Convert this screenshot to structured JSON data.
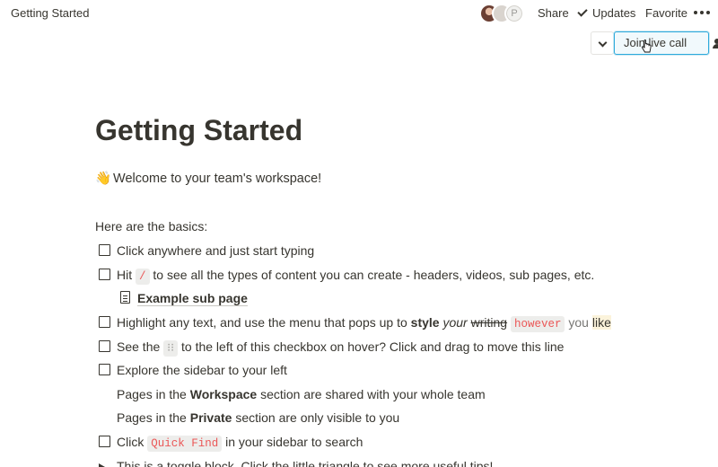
{
  "topbar": {
    "breadcrumb": "Getting Started",
    "avatar_initial": "P",
    "share_label": "Share",
    "updates_label": "Updates",
    "favorite_label": "Favorite"
  },
  "call": {
    "join_label": "Join live call"
  },
  "page": {
    "title": "Getting Started",
    "welcome": "Welcome to your team's workspace!",
    "basics": "Here are the basics:",
    "items": {
      "click": "Click anywhere and just start typing",
      "hit_pre": "Hit",
      "hit_code": "/",
      "hit_post": "to see all the types of content you can create - headers, videos, sub pages, etc.",
      "subpage": "Example sub page",
      "highlight_pre": "Highlight any text, and use the menu that pops up to",
      "highlight_style": "style",
      "highlight_your": "your",
      "highlight_writing": "writing",
      "highlight_however": "however",
      "highlight_you": "you",
      "highlight_like": "like",
      "see_pre": "See the",
      "see_code": "⁝⁝",
      "see_post": "to the left of this checkbox on hover? Click and drag to move this line",
      "explore": "Explore the sidebar to your left",
      "workspace_pre": "Pages in the",
      "workspace_bold": "Workspace",
      "workspace_post": "section are shared with your whole team",
      "private_pre": "Pages in the",
      "private_bold": "Private",
      "private_post": "section are only visible to you",
      "quick_pre": "Click",
      "quick_code": "Quick Find",
      "quick_post": "in your sidebar to search",
      "toggle": "This is a toggle block. Click the little triangle to see more useful tips!"
    }
  }
}
